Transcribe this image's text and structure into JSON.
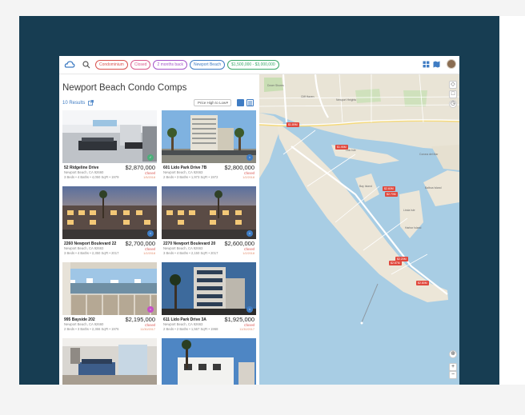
{
  "toolbar": {
    "chips": [
      {
        "label": "Condominium",
        "color": "#d9534f"
      },
      {
        "label": "Closed",
        "color": "#d85a8c"
      },
      {
        "label": "2 months back",
        "color": "#a455c9"
      },
      {
        "label": "Newport Beach",
        "color": "#3f7cc3"
      },
      {
        "label": "$1,500,000 - $3,000,000",
        "color": "#3aa86a"
      }
    ],
    "icons": [
      "search-icon",
      "grid-icon",
      "map-icon"
    ]
  },
  "list": {
    "title": "Newport Beach Condo Comps",
    "results": "10 Results",
    "sort_label": "Price High to Low",
    "cards": [
      {
        "address": "52 Ridgeline Drive",
        "price": "$2,870,000",
        "city": "Newport Beach, CA 92660",
        "status": "Closed",
        "specs": "3 Beds • 4 Baths • 4,050 SqFt • 1979",
        "date": "1/5/2018",
        "badge_color": "#4caf7a"
      },
      {
        "address": "601 Lido Park Drive 7B",
        "price": "$2,800,000",
        "city": "Newport Beach, CA 92663",
        "status": "Closed",
        "specs": "2 Beds • 3 Baths • 1,973 SqFt • 1972",
        "date": "1/2/2018",
        "badge_color": "#3f7cc3"
      },
      {
        "address": "2260 Newport Boulevard 22",
        "price": "$2,700,000",
        "city": "Newport Beach, CA 92663",
        "status": "Closed",
        "specs": "3 Beds • 4 Baths • 2,350 SqFt • 2017",
        "date": "1/2/2018",
        "badge_color": "#3f7cc3"
      },
      {
        "address": "2270 Newport Boulevard 20",
        "price": "$2,600,000",
        "city": "Newport Beach, CA 92663",
        "status": "Closed",
        "specs": "3 Beds • 4 Baths • 2,150 SqFt • 2017",
        "date": "1/2/2018",
        "badge_color": "#3f7cc3"
      },
      {
        "address": "995 Bayside 202",
        "price": "$2,195,000",
        "city": "Newport Beach, CA 92660",
        "status": "Closed",
        "specs": "2 Beds • 3 Baths • 2,366 SqFt • 1976",
        "date": "11/30/2017",
        "badge_color": "#c54fc7"
      },
      {
        "address": "611 Lido Park Drive 3A",
        "price": "$1,925,000",
        "city": "Newport Beach, CA 92663",
        "status": "Closed",
        "specs": "2 Beds • 2 Baths • 1,567 SqFt • 1968",
        "date": "11/30/2017",
        "badge_color": "#3f7cc3"
      },
      {
        "address": "",
        "price": "",
        "city": "",
        "status": "",
        "specs": "",
        "date": "",
        "badge_color": ""
      },
      {
        "address": "",
        "price": "",
        "city": "",
        "status": "",
        "specs": "",
        "date": "",
        "badge_color": ""
      }
    ]
  },
  "map": {
    "pins": [
      "$1.89M",
      "$1.95M",
      "$2.60M",
      "$2.70M",
      "$2.20M",
      "$2.87M",
      "$2.80M"
    ],
    "labels": [
      "Dover Shores",
      "Cliff Haven",
      "Newport Heights",
      "Lido Isle",
      "Bay Island",
      "Balboa Island",
      "Linda Isle",
      "Harbor Island",
      "Corona del Mar"
    ],
    "controls": [
      "+",
      "−"
    ]
  }
}
